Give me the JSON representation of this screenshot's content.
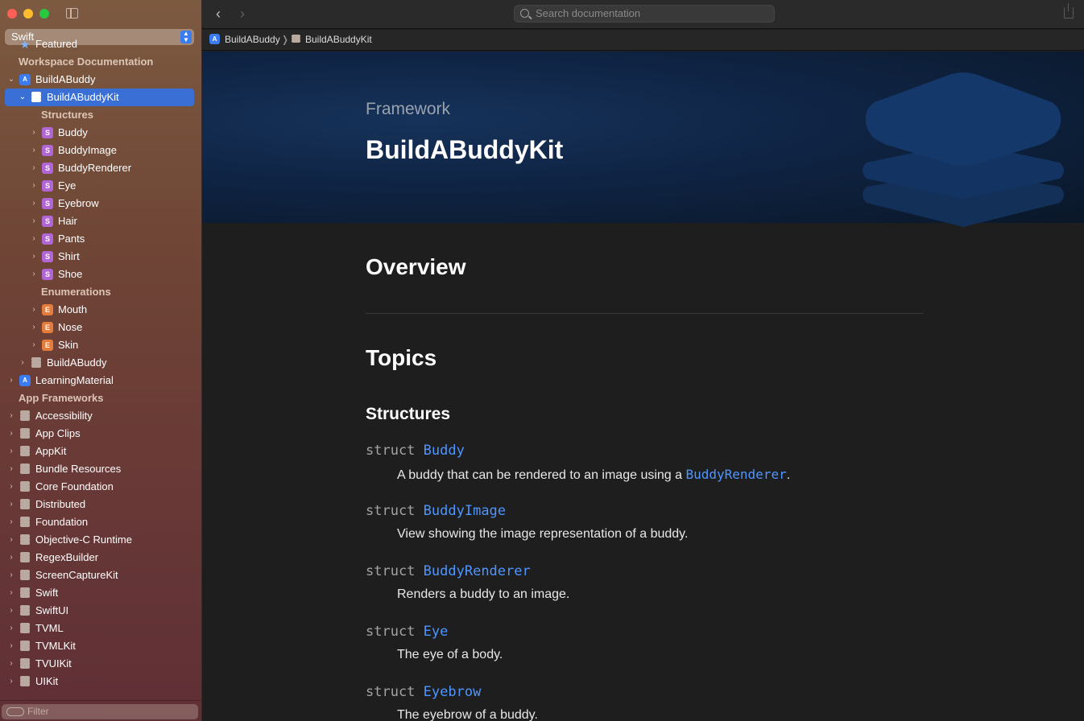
{
  "sidebar": {
    "language": "Swift",
    "filter_placeholder": "Filter",
    "items": {
      "featured": "Featured",
      "workspace_docs": "Workspace Documentation",
      "buildabuddy": "BuildABuddy",
      "buildabuddykit": "BuildABuddyKit",
      "structures": "Structures",
      "buddy": "Buddy",
      "buddyimage": "BuddyImage",
      "buddyrenderer": "BuddyRenderer",
      "eye": "Eye",
      "eyebrow": "Eyebrow",
      "hair": "Hair",
      "pants": "Pants",
      "shirt": "Shirt",
      "shoe": "Shoe",
      "enumerations": "Enumerations",
      "mouth": "Mouth",
      "nose": "Nose",
      "skin": "Skin",
      "buildabuddy_module": "BuildABuddy",
      "learningmaterial": "LearningMaterial",
      "app_frameworks": "App Frameworks",
      "accessibility": "Accessibility",
      "app_clips": "App Clips",
      "appkit": "AppKit",
      "bundle_resources": "Bundle Resources",
      "core_foundation": "Core Foundation",
      "distributed": "Distributed",
      "foundation": "Foundation",
      "objc_runtime": "Objective-C Runtime",
      "regexbuilder": "RegexBuilder",
      "screencapturekit": "ScreenCaptureKit",
      "swift": "Swift",
      "swiftui": "SwiftUI",
      "tvml": "TVML",
      "tvmlkit": "TVMLKit",
      "tvuikit": "TVUIKit",
      "uikit": "UIKit"
    },
    "badges": {
      "struct": "S",
      "enum": "E",
      "app": "A"
    }
  },
  "toolbar": {
    "search_placeholder": "Search documentation",
    "back": "‹",
    "forward": "›"
  },
  "breadcrumb": {
    "first": "BuildABuddy",
    "sep": "❭",
    "second": "BuildABuddyKit"
  },
  "hero": {
    "eyebrow": "Framework",
    "title": "BuildABuddyKit"
  },
  "main": {
    "overview": "Overview",
    "topics": "Topics",
    "structures_heading": "Structures",
    "keyword": "struct",
    "symbols": [
      {
        "name": "Buddy",
        "desc_pre": "A buddy that can be rendered to an image using a ",
        "desc_code": "BuddyRenderer",
        "desc_post": "."
      },
      {
        "name": "BuddyImage",
        "desc": "View showing the image representation of a buddy."
      },
      {
        "name": "BuddyRenderer",
        "desc": "Renders a buddy to an image."
      },
      {
        "name": "Eye",
        "desc": "The eye of a body."
      },
      {
        "name": "Eyebrow",
        "desc": "The eyebrow of a buddy."
      }
    ]
  },
  "colors": {
    "accent": "#3a70d6",
    "link": "#4e95ff",
    "hero_bg": "#0f2444"
  }
}
